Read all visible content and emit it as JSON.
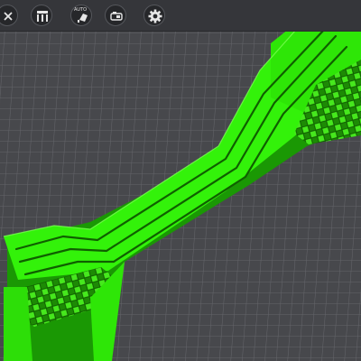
{
  "toolbar": {
    "buttons": [
      {
        "name": "close",
        "icon": "close-icon"
      },
      {
        "name": "supports",
        "icon": "supports-icon"
      },
      {
        "name": "auto-supports",
        "icon": "auto-supports-icon",
        "label": "AUTO"
      },
      {
        "name": "slice",
        "icon": "slice-icon"
      },
      {
        "name": "settings",
        "icon": "gear-icon"
      }
    ]
  },
  "colors": {
    "toolbar_bg": "#35363a",
    "viewport_bg": "#47484c",
    "grid_line": "#6a6b70",
    "model_green": "#33f20a",
    "model_green_dark": "#1c9e04",
    "model_green_shadow": "#0f5f00",
    "icon": "#e6e6e6"
  }
}
